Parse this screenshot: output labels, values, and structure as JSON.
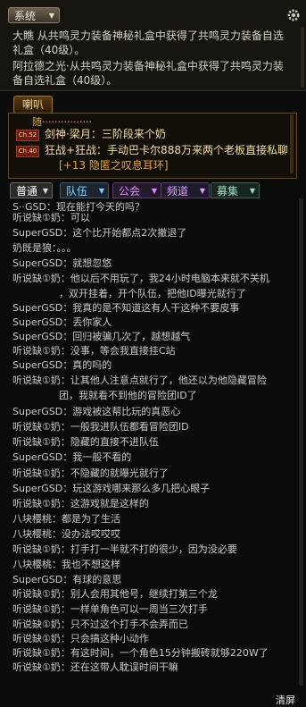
{
  "system": {
    "tab_label": "系统",
    "lines": [
      "大瞧 从共鸣灵力装备神秘礼盒中获得了共鸣灵力装备自选",
      "礼盒（40级）。",
      "阿拉德之光·从共鸣灵力装备神秘礼盒中获得了共鸣灵力装",
      "备自选礼盒（40级）。"
    ]
  },
  "horn": {
    "tab_label": "喇叭",
    "header": "随················",
    "messages": [
      {
        "badge": "Ch.52",
        "text": "剑神·梁月：三阶段来个奶",
        "color": "#f0e0a0"
      },
      {
        "badge": "Ch.40",
        "text": "狂战+狂战：手动巴卡尔888万来两个老板直接私聊",
        "color": "#f0e0a0"
      },
      {
        "badge": "",
        "text": "[+13 隐匿之叹息耳环]",
        "color": "#e7a23c"
      }
    ]
  },
  "channels": [
    {
      "label": "普通",
      "color": "#ffffff",
      "bg": "#2a2a2a"
    },
    {
      "label": "队伍",
      "color": "#7fd0ff",
      "bg": "#1a2530"
    },
    {
      "label": "公会",
      "color": "#e58aff",
      "bg": "#241a2b"
    },
    {
      "label": "频道",
      "color": "#d7a4ff",
      "bg": "#201a2b"
    },
    {
      "label": "募集",
      "color": "#9fe0c0",
      "bg": "#1a2520"
    }
  ],
  "chat": [
    {
      "name": "S··GSD",
      "text": "：现在能打今天的吗？"
    },
    {
      "name": "听说缺①奶",
      "text": "：可以"
    },
    {
      "name": "SuperGSD",
      "text": "：这个比开始都点2次撤退了"
    },
    {
      "name": "奶既是狼",
      "text": "：。。。"
    },
    {
      "name": "SuperGSD",
      "text": "：就想忽悠"
    },
    {
      "name": "听说缺①奶",
      "text": "：他以后不用玩了，我24小时电脑本来就不关机"
    },
    {
      "name": "",
      "text": "，双开挂着，开个队伍，把他ID曝光就行了"
    },
    {
      "name": "SuperGSD",
      "text": "：我真的是不知道这有人干这种不要皮事"
    },
    {
      "name": "SuperGSD",
      "text": "：丢你家人"
    },
    {
      "name": "SuperGSD",
      "text": "：回归被骗几次了，越想越气"
    },
    {
      "name": "听说缺①奶",
      "text": "：没事，等会我直接挂C站"
    },
    {
      "name": "SuperGSD",
      "text": "：真的吗的"
    },
    {
      "name": "听说缺①奶",
      "text": "：让其他人注意点就行了，他还以为他隐藏冒险"
    },
    {
      "name": "",
      "text": "团，我就看不到他的冒险团ID了"
    },
    {
      "name": "SuperGSD",
      "text": "：游戏被这帮比玩的真恶心"
    },
    {
      "name": "听说缺①奶",
      "text": "：一般我进队伍都看冒险团ID"
    },
    {
      "name": "听说缺①奶",
      "text": "：隐藏的直接不进队伍"
    },
    {
      "name": "SuperGSD",
      "text": "：我一般不看的"
    },
    {
      "name": "听说缺①奶",
      "text": "：不隐藏的就曝光就行了"
    },
    {
      "name": "SuperGSD",
      "text": "：玩这游戏哪来那么多几把心眼子"
    },
    {
      "name": "听说缺①奶",
      "text": "：这游戏就是这样的"
    },
    {
      "name": "八块樱桃",
      "text": "：都是为了生活"
    },
    {
      "name": "八块樱桃",
      "text": "：没办法哎哎哎"
    },
    {
      "name": "听说缺①奶",
      "text": "：打手打一半就不打的很少，因为没必要"
    },
    {
      "name": "八块樱桃",
      "text": "：我也不想这样"
    },
    {
      "name": "SuperGSD",
      "text": "：有球的意思"
    },
    {
      "name": "听说缺①奶",
      "text": "：别人会用其他号，继续打第三个龙"
    },
    {
      "name": "听说缺①奶",
      "text": "：一样单角色可以一周当三次打手"
    },
    {
      "name": "听说缺①奶",
      "text": "：只不过这个打手不会弄而已"
    },
    {
      "name": "听说缺①奶",
      "text": "：只会搞这种小动作"
    },
    {
      "name": "听说缺①奶",
      "text": "：有这时间，一个角色15分钟搬砖就够220W了"
    },
    {
      "name": "听说缺①奶",
      "text": "：还在这带人耽误时间干嘛"
    }
  ],
  "clear_label": "清屏"
}
